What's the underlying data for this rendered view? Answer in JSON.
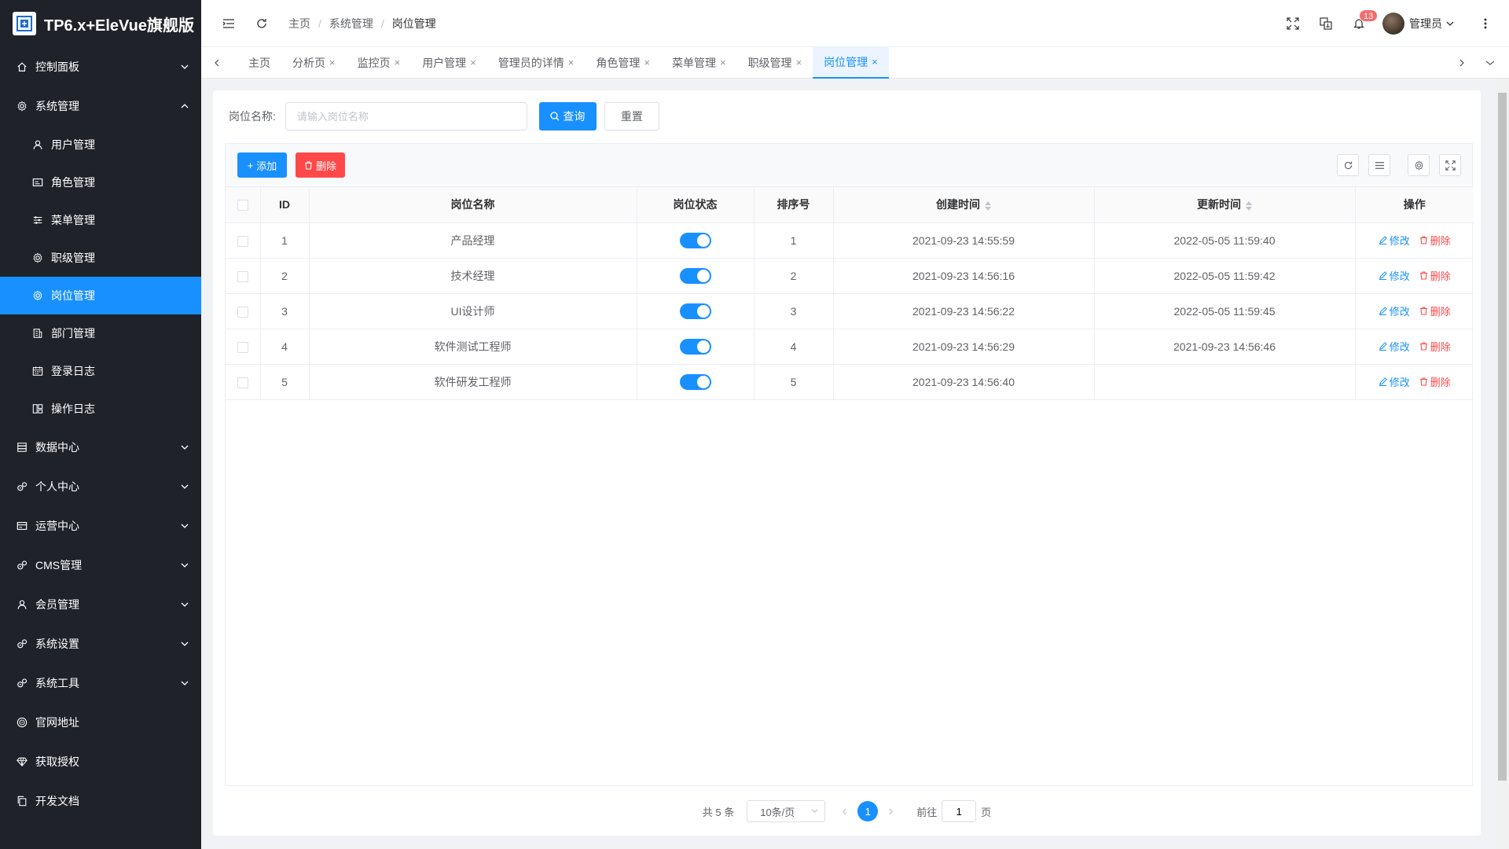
{
  "app": {
    "title": "TP6.x+EleVue旗舰版"
  },
  "sidebar": {
    "items": [
      {
        "label": "控制面板",
        "icon": "home-icon",
        "expandable": true
      },
      {
        "label": "系统管理",
        "icon": "gear-icon",
        "expandable": true,
        "open": true,
        "children": [
          {
            "label": "用户管理",
            "icon": "user-icon"
          },
          {
            "label": "角色管理",
            "icon": "id-card-icon"
          },
          {
            "label": "菜单管理",
            "icon": "sliders-icon"
          },
          {
            "label": "职级管理",
            "icon": "gear-icon"
          },
          {
            "label": "岗位管理",
            "icon": "gear-icon",
            "active": true
          },
          {
            "label": "部门管理",
            "icon": "building-icon"
          },
          {
            "label": "登录日志",
            "icon": "calendar-icon"
          },
          {
            "label": "操作日志",
            "icon": "layout-icon"
          }
        ]
      },
      {
        "label": "数据中心",
        "icon": "server-icon",
        "expandable": true
      },
      {
        "label": "个人中心",
        "icon": "gears-icon",
        "expandable": true
      },
      {
        "label": "运营中心",
        "icon": "card-icon",
        "expandable": true
      },
      {
        "label": "CMS管理",
        "icon": "gears-icon",
        "expandable": true
      },
      {
        "label": "会员管理",
        "icon": "user-icon",
        "expandable": true
      },
      {
        "label": "系统设置",
        "icon": "gears-icon",
        "expandable": true
      },
      {
        "label": "系统工具",
        "icon": "gears-icon",
        "expandable": true
      },
      {
        "label": "官网地址",
        "icon": "globe-icon"
      },
      {
        "label": "获取授权",
        "icon": "diamond-icon"
      },
      {
        "label": "开发文档",
        "icon": "copy-icon"
      }
    ]
  },
  "header": {
    "breadcrumb": [
      "主页",
      "系统管理",
      "岗位管理"
    ],
    "notification_count": "13",
    "user_name": "管理员"
  },
  "tabs": [
    {
      "label": "主页",
      "closable": false
    },
    {
      "label": "分析页",
      "closable": true
    },
    {
      "label": "监控页",
      "closable": true
    },
    {
      "label": "用户管理",
      "closable": true
    },
    {
      "label": "管理员的详情",
      "closable": true
    },
    {
      "label": "角色管理",
      "closable": true
    },
    {
      "label": "菜单管理",
      "closable": true
    },
    {
      "label": "职级管理",
      "closable": true
    },
    {
      "label": "岗位管理",
      "closable": true,
      "active": true
    }
  ],
  "search": {
    "label": "岗位名称:",
    "placeholder": "请输入岗位名称",
    "value": "",
    "query_label": "查询",
    "reset_label": "重置"
  },
  "toolbar": {
    "add_label": "添加",
    "delete_label": "删除"
  },
  "table": {
    "columns": [
      "ID",
      "岗位名称",
      "岗位状态",
      "排序号",
      "创建时间",
      "更新时间",
      "操作"
    ],
    "rows": [
      {
        "id": "1",
        "name": "产品经理",
        "status_on": true,
        "sort": "1",
        "created": "2021-09-23 14:55:59",
        "updated": "2022-05-05 11:59:40"
      },
      {
        "id": "2",
        "name": "技术经理",
        "status_on": true,
        "sort": "2",
        "created": "2021-09-23 14:56:16",
        "updated": "2022-05-05 11:59:42"
      },
      {
        "id": "3",
        "name": "UI设计师",
        "status_on": true,
        "sort": "3",
        "created": "2021-09-23 14:56:22",
        "updated": "2022-05-05 11:59:45"
      },
      {
        "id": "4",
        "name": "软件测试工程师",
        "status_on": true,
        "sort": "4",
        "created": "2021-09-23 14:56:29",
        "updated": "2021-09-23 14:56:46"
      },
      {
        "id": "5",
        "name": "软件研发工程师",
        "status_on": true,
        "sort": "5",
        "created": "2021-09-23 14:56:40",
        "updated": ""
      }
    ],
    "edit_label": "修改",
    "delete_label": "删除"
  },
  "pagination": {
    "total_text": "共 5 条",
    "page_size": "10条/页",
    "current_page": "1",
    "goto_prefix": "前往",
    "goto_value": "1",
    "goto_suffix": "页"
  },
  "colors": {
    "primary": "#1890ff",
    "danger": "#ff4949",
    "sidebar_bg": "#20222a"
  }
}
